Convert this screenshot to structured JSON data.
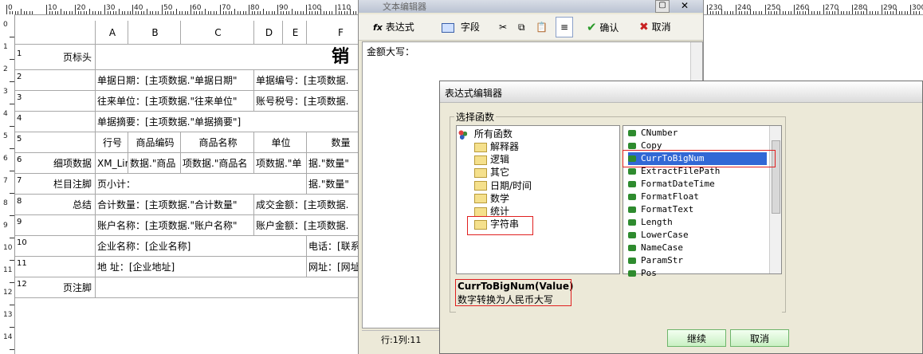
{
  "ruler": {
    "h_labels": [
      "0",
      "10",
      "20",
      "30",
      "40",
      "50",
      "60",
      "70",
      "80",
      "90",
      "100",
      "110",
      "230",
      "240",
      "250",
      "260",
      "270",
      "280",
      "290",
      "300",
      "310"
    ],
    "v_labels": [
      "0",
      "1",
      "2",
      "3",
      "4",
      "5",
      "6",
      "7",
      "8",
      "9",
      "10",
      "11",
      "12",
      "13",
      "14",
      "15"
    ]
  },
  "grid": {
    "col_headers": [
      "A",
      "B",
      "C",
      "D",
      "E",
      "F"
    ],
    "rows": [
      {
        "num": "1",
        "label": "页标头",
        "cells": [
          "销"
        ]
      },
      {
        "num": "2",
        "label": "",
        "cells": [
          "单据日期：[主项数据.\"单据日期\"",
          "单据编号：[主项数据."
        ]
      },
      {
        "num": "3",
        "label": "",
        "cells": [
          "往来单位：[主项数据.\"往来单位\"",
          "账号税号：[主项数据."
        ]
      },
      {
        "num": "4",
        "label": "",
        "cells": [
          "单据摘要：[主项数据.\"单据摘要\"]"
        ]
      },
      {
        "num": "5",
        "label": "",
        "cells": [
          "行号",
          "商品编码",
          "商品名称",
          "单位",
          "数量"
        ]
      },
      {
        "num": "6",
        "label": "细项数据",
        "cells": [
          "XM_Lir",
          "数据.\"商品",
          "项数据.\"商品名",
          "项数据.\"单",
          "据.\"数量\""
        ]
      },
      {
        "num": "7",
        "label": "栏目注脚",
        "cells": [
          "页小计：",
          "据.\"数量\""
        ]
      },
      {
        "num": "8",
        "label": "总结",
        "cells": [
          "合计数量：[主项数据.\"合计数量\"",
          "成交金额：[主项数据."
        ]
      },
      {
        "num": "9",
        "label": "",
        "cells": [
          "账户名称：[主项数据.\"账户名称\"",
          "账户金额：[主项数据."
        ]
      },
      {
        "num": "10",
        "label": "",
        "cells": [
          "企业名称：[企业名称]",
          "电话：[联系"
        ]
      },
      {
        "num": "11",
        "label": "",
        "cells": [
          "地    址：[企业地址]",
          "网址：[网址"
        ]
      },
      {
        "num": "12",
        "label": "页注脚",
        "cells": []
      }
    ]
  },
  "text_editor": {
    "title": "文本编辑器",
    "toolbar": {
      "expr_label": "表达式",
      "field_label": "字段",
      "ok_label": "确认",
      "cancel_label": "取消"
    },
    "content": "金额大写：",
    "status": "行:1列:11"
  },
  "expr_dialog": {
    "title": "表达式编辑器",
    "group_label": "选择函数",
    "tree_root": "所有函数",
    "tree_items": [
      "解释器",
      "逻辑",
      "其它",
      "日期/时间",
      "数学",
      "统计",
      "字符串"
    ],
    "functions": [
      "CNumber",
      "Copy",
      "CurrToBigNum",
      "ExtractFilePath",
      "FormatDateTime",
      "FormatFloat",
      "FormatText",
      "Length",
      "LowerCase",
      "NameCase",
      "ParamStr",
      "Pos"
    ],
    "selected_function": "CurrToBigNum",
    "desc_signature": "CurrToBigNum(Value)",
    "desc_text": "数字转换为人民币大写",
    "continue_label": "继续",
    "cancel_label": "取消"
  },
  "colors": {
    "selection": "#3168d5",
    "highlight_box": "#e02020",
    "button_green": "#c9f0c3",
    "dialog_bg": "#ece9d8"
  }
}
